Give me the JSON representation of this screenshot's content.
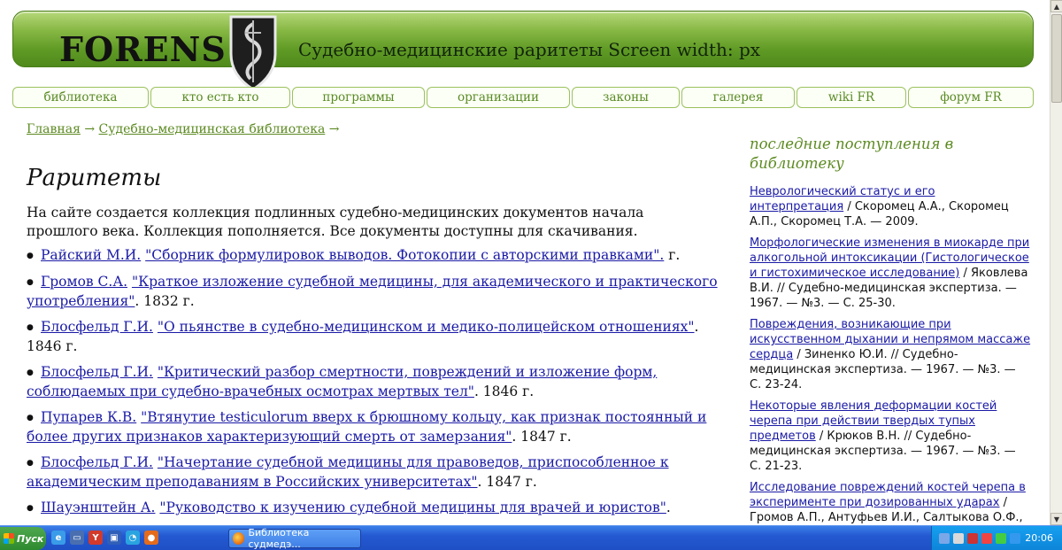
{
  "header": {
    "logo": "FORENS",
    "tagline": "Судебно-медицинские раритеты Screen width: px"
  },
  "nav": [
    {
      "label": "библиотека",
      "w": 154
    },
    {
      "label": "кто есть кто",
      "w": 158
    },
    {
      "label": "программы",
      "w": 150
    },
    {
      "label": "организации",
      "w": 162
    },
    {
      "label": "законы",
      "w": 122
    },
    {
      "label": "галерея",
      "w": 128
    },
    {
      "label": "wiki FR",
      "w": 124
    },
    {
      "label": "форум FR",
      "w": 142
    }
  ],
  "breadcrumb": {
    "home": "Главная",
    "arrow": "→",
    "section": "Судебно-медицинская библиотека"
  },
  "main": {
    "title": "Раритеты",
    "intro": "На сайте создается коллекция подлинных судебно-медицинских документов начала прошлого века. Коллекция пополняется. Все документы доступны для скачивания.",
    "items": [
      {
        "author": "Райский М.И.",
        "title": "\"Сборник формулировок выводов. Фотокопии с авторскими правками\".",
        "year": " г."
      },
      {
        "author": "Громов С.А.",
        "title": "\"Краткое изложение судебной медицины, для академического и практического употребления\"",
        "year": ". 1832 г."
      },
      {
        "author": "Блосфельд Г.И.",
        "title": "\"О пьянстве в судебно-медицинском и медико-полицейском отношениях\"",
        "year": ". 1846 г."
      },
      {
        "author": "Блосфельд Г.И.",
        "title": "\"Критический разбор смертности, повреждений и изложение форм, соблюдаемых при судебно-врачебных осмотрах мертвых тел\"",
        "year": ". 1846 г."
      },
      {
        "author": "Пупарев К.В.",
        "title": "\"Втянутие testiculorum вверх к брюшному кольцу, как признак постоянный и более других признаков характеризующий смерть от замерзания\"",
        "year": ". 1847 г."
      },
      {
        "author": "Блосфельд Г.И.",
        "title": "\"Начертание судебной медицины для правоведов, приспособленное к академическим преподаваниям в Российских университетах\"",
        "year": ". 1847 г."
      },
      {
        "author": "Шауэнштейн А.",
        "title": "\"Руководство к изучению судебной медицины для врачей и юристов\"",
        "year": "."
      }
    ]
  },
  "sidebar": {
    "heading": "последние поступления в библиотеку",
    "items": [
      {
        "link": "Неврологический статус и его интерпретация",
        "rest": " / Скоромец А.А., Скоромец А.П., Скоромец Т.А. — 2009."
      },
      {
        "link": "Морфологические изменения в миокарде при алкогольной интоксикации (Гистологическое и гистохимическое исследование)",
        "rest": " / Яковлева В.И. // Судебно-медицинская экспертиза. — 1967. — №3. — С. 25-30."
      },
      {
        "link": "Повреждения, возникающие при искусственном дыхании и непрямом массаже сердца",
        "rest": " / Зиненко Ю.И. // Судебно-медицинская экспертиза. — 1967. — №3. — С. 23-24."
      },
      {
        "link": "Некоторые явления деформации костей черепа при действии твердых тупых предметов",
        "rest": " / Крюков В.Н. // Судебно-медицинская экспертиза. — 1967. — №3. — С. 21-23."
      },
      {
        "link": "Исследование повреждений костей черепа в эксперименте при дозированных ударах",
        "rest": " / Громов А.П., Антуфьев И.И., Салтыкова О.Ф., "
      }
    ]
  },
  "taskbar": {
    "start": "Пуск",
    "window": "Библиотека судмедэ...",
    "clock": "20:06"
  },
  "colors": {
    "green_link": "#5c8a21",
    "link": "#1a1aa6",
    "banner_green": "#5f9a25",
    "taskbar_blue": "#245edb"
  }
}
